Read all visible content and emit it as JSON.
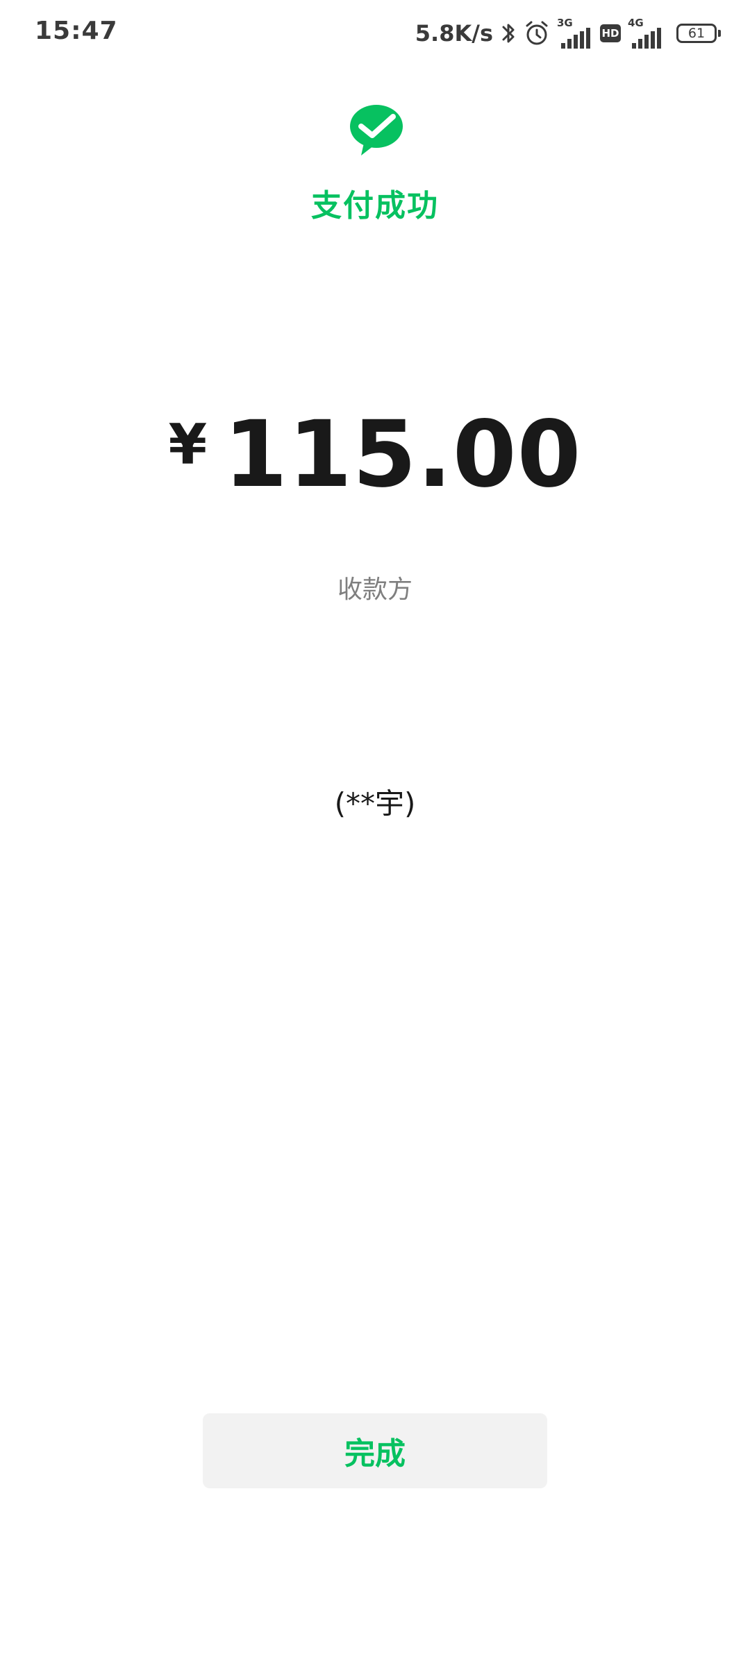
{
  "status_bar": {
    "time": "15:47",
    "net_speed": "5.8K/s",
    "sim1_network": "3G",
    "hd_badge": "HD",
    "sim2_network": "4G",
    "battery_level": "61",
    "icons": [
      "bluetooth-icon",
      "alarm-icon",
      "signal-icon",
      "hd-icon",
      "signal-icon",
      "battery-icon"
    ]
  },
  "header": {
    "logo_icon": "wechat-pay-icon",
    "title": "支付成功"
  },
  "payment": {
    "currency_symbol": "¥",
    "amount": "115.00"
  },
  "payee": {
    "label": "收款方",
    "name": "(**宇)"
  },
  "actions": {
    "done_label": "完成"
  },
  "colors": {
    "accent": "#07c160",
    "text_primary": "#191919",
    "text_secondary": "#7f7f7f",
    "button_bg": "#f2f2f2",
    "status_icons": "#3a3a3a",
    "background": "#ffffff"
  }
}
